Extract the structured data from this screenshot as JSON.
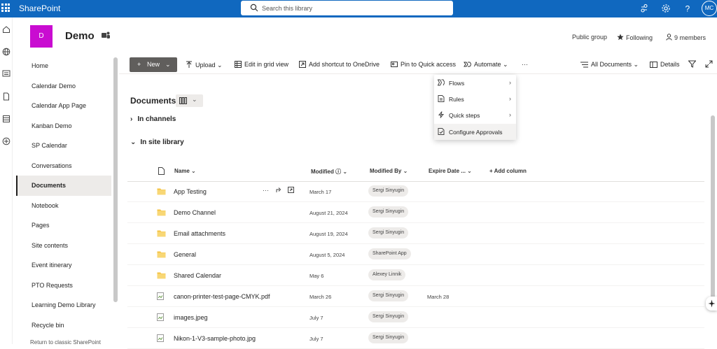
{
  "app": {
    "name": "SharePoint",
    "user_initials": "MC"
  },
  "search": {
    "placeholder": "Search this library"
  },
  "site": {
    "logo_letter": "D",
    "title": "Demo",
    "group_type": "Public group",
    "following_label": "Following",
    "members_label": "9 members"
  },
  "leftnav": {
    "items": [
      {
        "label": "Home"
      },
      {
        "label": "Calendar Demo"
      },
      {
        "label": "Calendar App Page"
      },
      {
        "label": "Kanban Demo"
      },
      {
        "label": "SP Calendar"
      },
      {
        "label": "Conversations"
      },
      {
        "label": "Documents",
        "active": true
      },
      {
        "label": "Notebook"
      },
      {
        "label": "Pages"
      },
      {
        "label": "Site contents"
      },
      {
        "label": "Event itinerary"
      },
      {
        "label": "PTO Requests"
      },
      {
        "label": "Learning Demo Library"
      },
      {
        "label": "Recycle bin"
      }
    ],
    "classic_link": "Return to classic SharePoint"
  },
  "commandbar": {
    "new": "New",
    "upload": "Upload",
    "edit_grid": "Edit in grid view",
    "add_shortcut": "Add shortcut to OneDrive",
    "pin": "Pin to Quick access",
    "automate": "Automate",
    "more": "···",
    "view": "All Documents",
    "details": "Details"
  },
  "automate_menu": {
    "items": [
      {
        "label": "Flows",
        "submenu": true
      },
      {
        "label": "Rules",
        "submenu": true
      },
      {
        "label": "Quick steps",
        "submenu": true
      },
      {
        "label": "Configure Approvals",
        "submenu": false
      }
    ]
  },
  "library": {
    "title": "Documents",
    "groups": {
      "channels": "In channels",
      "site": "In site library"
    },
    "columns": {
      "name": "Name",
      "modified": "Modified",
      "modified_by": "Modified By",
      "expire": "Expire Date ...",
      "add": "Add column"
    },
    "rows": [
      {
        "name": "App Testing",
        "type": "folder",
        "modified": "March 17",
        "by": "Sergi Sinyugin",
        "expire": ""
      },
      {
        "name": "Demo Channel",
        "type": "folder",
        "modified": "August 21, 2024",
        "by": "Sergi Sinyugin",
        "expire": ""
      },
      {
        "name": "Email attachments",
        "type": "folder",
        "modified": "August 19, 2024",
        "by": "Sergi Sinyugin",
        "expire": ""
      },
      {
        "name": "General",
        "type": "folder",
        "modified": "August 5, 2024",
        "by": "SharePoint App",
        "expire": ""
      },
      {
        "name": "Shared Calendar",
        "type": "folder",
        "modified": "May 6",
        "by": "Alexey Linnik",
        "expire": ""
      },
      {
        "name": "canon-printer-test-page-CMYK.pdf",
        "type": "file",
        "modified": "March 26",
        "by": "Sergi Sinyugin",
        "expire": "March 28"
      },
      {
        "name": "images.jpeg",
        "type": "image",
        "modified": "July 7",
        "by": "Sergi Sinyugin",
        "expire": ""
      },
      {
        "name": "Nikon-1-V3-sample-photo.jpg",
        "type": "image",
        "modified": "July 7",
        "by": "Sergi Sinyugin",
        "expire": ""
      }
    ]
  },
  "colors": {
    "suite_bar": "#1068bf",
    "site_logo": "#c90cd1",
    "folder": "#f5c343",
    "new_button": "#605e5c"
  }
}
